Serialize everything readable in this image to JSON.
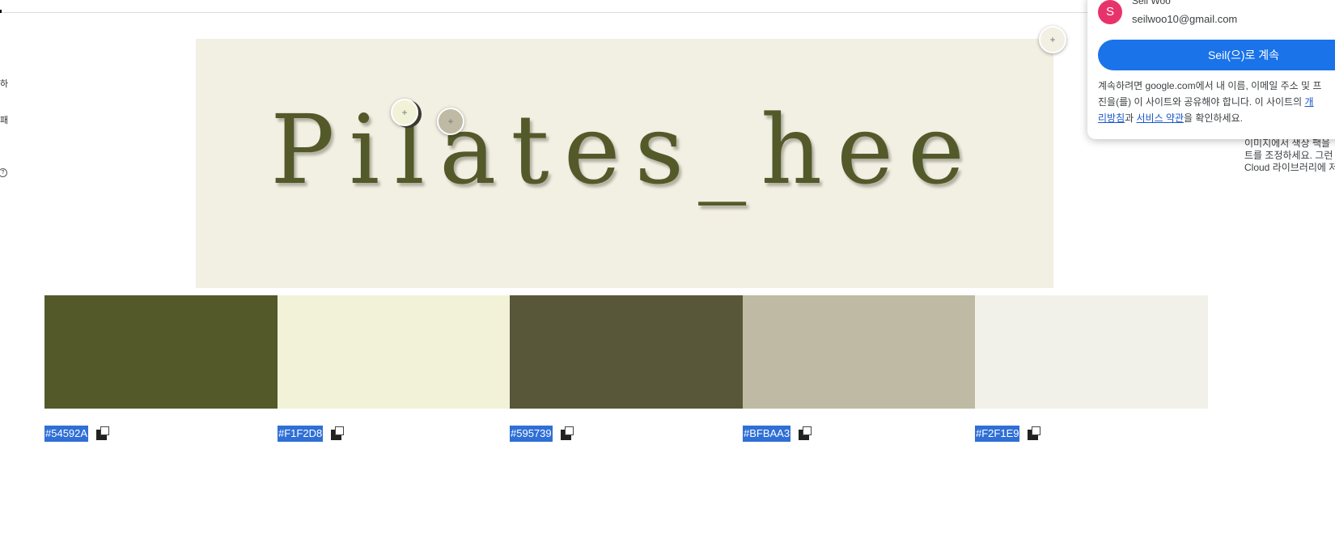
{
  "left_fragments": [
    "하",
    "패",
    "?"
  ],
  "hero": {
    "title": "Pilates_hee"
  },
  "pickers": [
    "+",
    "+",
    "+"
  ],
  "palette": [
    {
      "hex": "#54592A",
      "color": "#54592a"
    },
    {
      "hex": "#F1F2D8",
      "color": "#f1f2d8"
    },
    {
      "hex": "#595739",
      "color": "#595739"
    },
    {
      "hex": "#BFBAA3",
      "color": "#bfbaa3"
    },
    {
      "hex": "#F2F1E9",
      "color": "#f2f1e9"
    }
  ],
  "side_text": {
    "line1": "이미지에서 색상 팩을",
    "line2": "트를 조정하세요. 그런",
    "line3": "Cloud 라이브러리에 저"
  },
  "account_popup": {
    "avatar_letter": "S",
    "name": "Seil Woo",
    "email": "seilwoo10@gmail.com",
    "continue_label": "Seil(으)로 계속",
    "consent_line1": "계속하려면 google.com에서 내 이름, 이메일 주소 및 프",
    "consent_line2": "진을(를) 이 사이트와 공유해야 합니다. 이 사이트의 ",
    "privacy_link_part1": "개",
    "privacy_link_part2": "리방침",
    "and_text": "과 ",
    "terms_link": "서비스 약관",
    "consent_end": "을 확인하세요."
  }
}
